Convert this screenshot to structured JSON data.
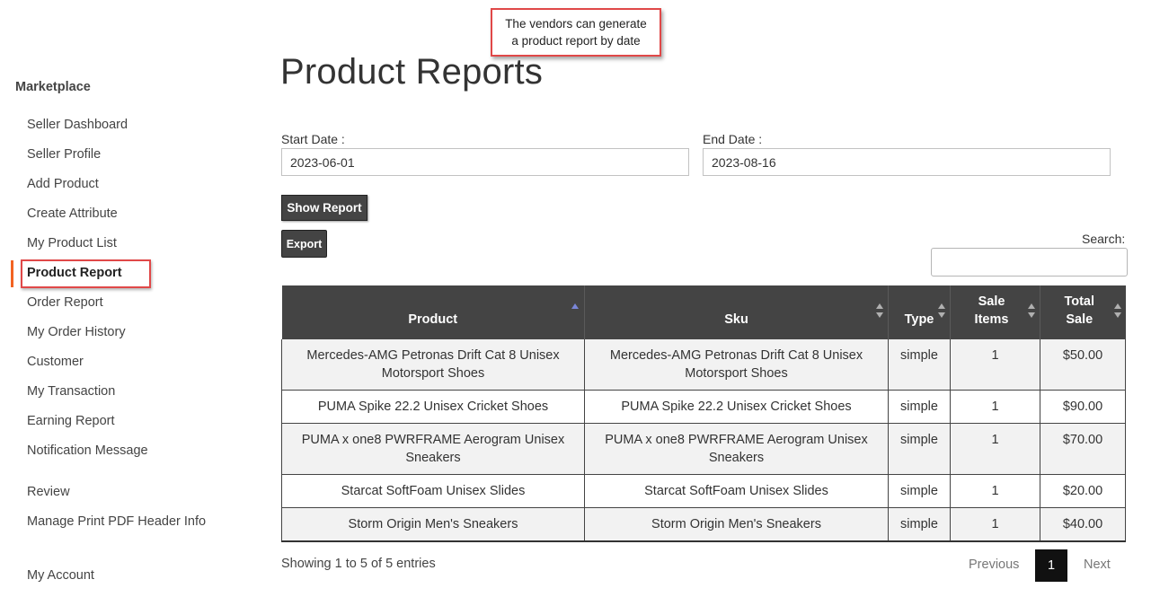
{
  "callout": {
    "line1": "The vendors can generate",
    "line2": "a product report by date"
  },
  "sidebar": {
    "title": "Marketplace",
    "items": [
      {
        "label": "Seller Dashboard"
      },
      {
        "label": "Seller Profile"
      },
      {
        "label": "Add Product"
      },
      {
        "label": "Create Attribute"
      },
      {
        "label": "My Product List"
      },
      {
        "label": "Product Report",
        "active": true
      },
      {
        "label": "Order Report"
      },
      {
        "label": "My Order History"
      },
      {
        "label": "Customer"
      },
      {
        "label": "My Transaction"
      },
      {
        "label": "Earning Report"
      },
      {
        "label": "Notification Message"
      },
      {
        "label": "Review"
      },
      {
        "label": "Manage Print PDF Header Info"
      },
      {
        "label": "My Account"
      }
    ],
    "accent_color": "#f26322",
    "highlight_color": "#e04848"
  },
  "main": {
    "title": "Product Reports",
    "start_date": {
      "label": "Start Date :",
      "value": "2023-06-01"
    },
    "end_date": {
      "label": "End Date :",
      "value": "2023-08-16"
    },
    "show_report_label": "Show Report",
    "export_label": "Export",
    "search_label": "Search:",
    "search_value": ""
  },
  "table": {
    "columns": [
      {
        "label": "Product",
        "sort": "ascending"
      },
      {
        "label": "Sku",
        "sort": "none"
      },
      {
        "label": "Type",
        "sort": "none"
      },
      {
        "label": "Sale Items",
        "sort": "none"
      },
      {
        "label": "Total Sale",
        "sort": "none"
      }
    ],
    "rows": [
      {
        "product": "Mercedes-AMG Petronas Drift Cat 8 Unisex Motorsport Shoes",
        "sku": "Mercedes-AMG Petronas Drift Cat 8 Unisex Motorsport Shoes",
        "type": "simple",
        "sale_items": "1",
        "total_sale": "$50.00"
      },
      {
        "product": "PUMA Spike 22.2 Unisex Cricket Shoes",
        "sku": "PUMA Spike 22.2 Unisex Cricket Shoes",
        "type": "simple",
        "sale_items": "1",
        "total_sale": "$90.00"
      },
      {
        "product": "PUMA x one8 PWRFRAME Aerogram Unisex Sneakers",
        "sku": "PUMA x one8 PWRFRAME Aerogram Unisex Sneakers",
        "type": "simple",
        "sale_items": "1",
        "total_sale": "$70.00"
      },
      {
        "product": "Starcat SoftFoam Unisex Slides",
        "sku": "Starcat SoftFoam Unisex Slides",
        "type": "simple",
        "sale_items": "1",
        "total_sale": "$20.00"
      },
      {
        "product": "Storm Origin Men's Sneakers",
        "sku": "Storm Origin Men's Sneakers",
        "type": "simple",
        "sale_items": "1",
        "total_sale": "$40.00"
      }
    ],
    "header_color": "#444444"
  },
  "footer": {
    "info": "Showing 1 to 5 of 5 entries",
    "previous_label": "Previous",
    "current_page": "1",
    "next_label": "Next"
  }
}
